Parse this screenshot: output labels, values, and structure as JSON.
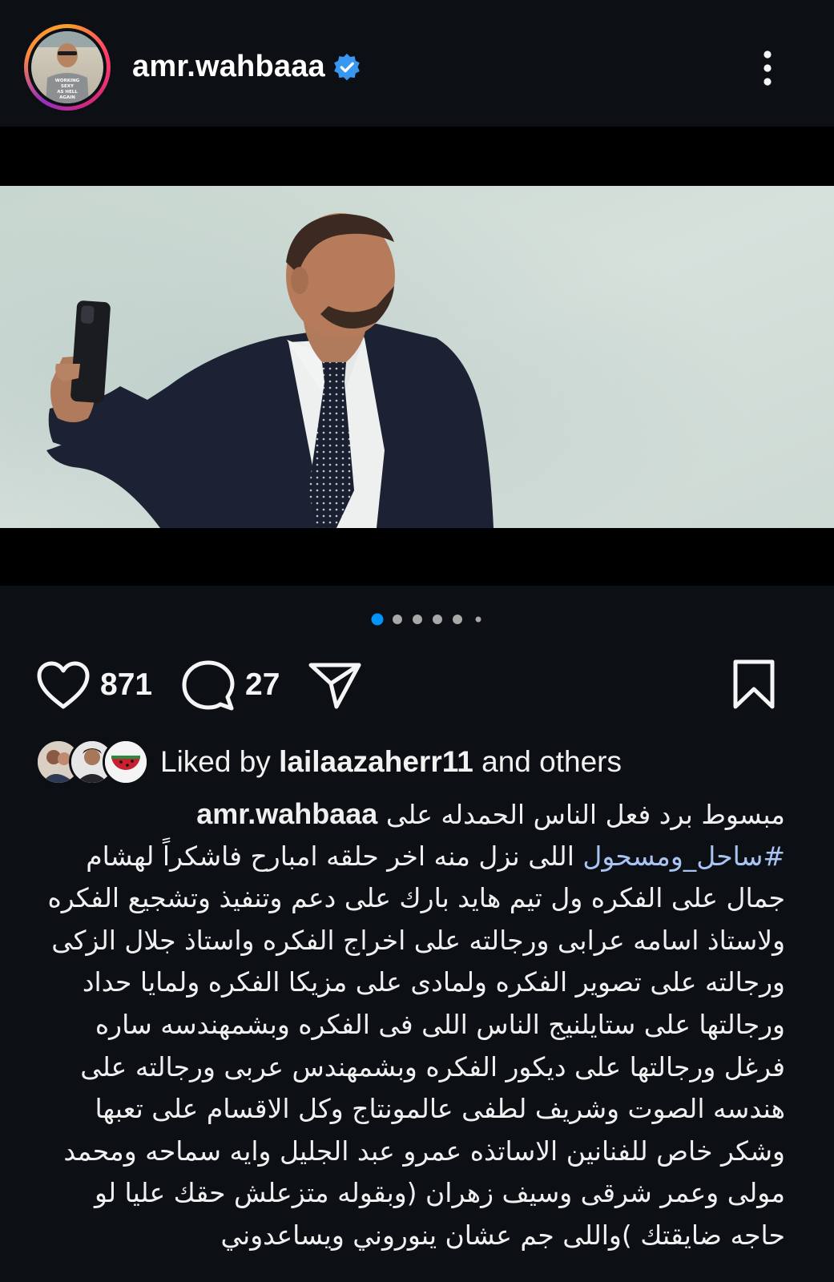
{
  "header": {
    "username": "amr.wahbaaa",
    "verified_icon": "verified-badge-icon",
    "more_icon": "more-vertical-icon",
    "avatar_shirt_text": "WORKING SEXY AS HELL AGAIN",
    "colors": {
      "verified": "#3897f0",
      "ring_start": "#f9a02b",
      "ring_end": "#962fbf"
    }
  },
  "carousel": {
    "total_dots": 6,
    "active_index": 0,
    "active_color": "#0095f6",
    "inactive_color": "#a8a8a8"
  },
  "actions": {
    "like_icon": "heart-icon",
    "like_count": "871",
    "comment_icon": "comment-bubble-icon",
    "comment_count": "27",
    "share_icon": "send-icon",
    "save_icon": "bookmark-icon"
  },
  "liked_by": {
    "prefix": "Liked by ",
    "user": "lailaazaherr11",
    "suffix": " and others"
  },
  "caption": {
    "username": "amr.wahbaaa",
    "line1": "مبسوط برد فعل الناس الحمدله على",
    "line2_hashtag": "#ساحل_ومسحول",
    "line2_rest": " اللى نزل منه اخر حلقه امبارح فاشكراً لهشام",
    "line3": "جمال على الفكره ول تيم هايد بارك على دعم وتنفيذ وتشجيع الفكره",
    "line4": "ولاستاذ اسامه عرابى ورجالته على اخراج الفكره واستاذ جلال الزكى",
    "line5": "ورجالته على تصوير الفكره ولمادى على مزيكا الفكره ولمايا حداد",
    "line6": "ورجالتها على ستايلنيج الناس اللى فى الفكره وبشمهندسه ساره",
    "line7": "فرغل ورجالتها على ديكور الفكره وبشمهندس عربى ورجالته على",
    "line8": "هندسه الصوت وشريف لطفى عالمونتاج وكل الاقسام على تعبها",
    "line9": "وشكر خاص للفنانين الاساتذه عمرو عبد الجليل وايه سماحه ومحمد",
    "line10": "مولى وعمر شرقى وسيف زهران (وبقوله متزعلش حقك عليا لو",
    "line11": "حاجه ضايقتك )واللى جم عشان ينوروني ويساعدوني"
  }
}
